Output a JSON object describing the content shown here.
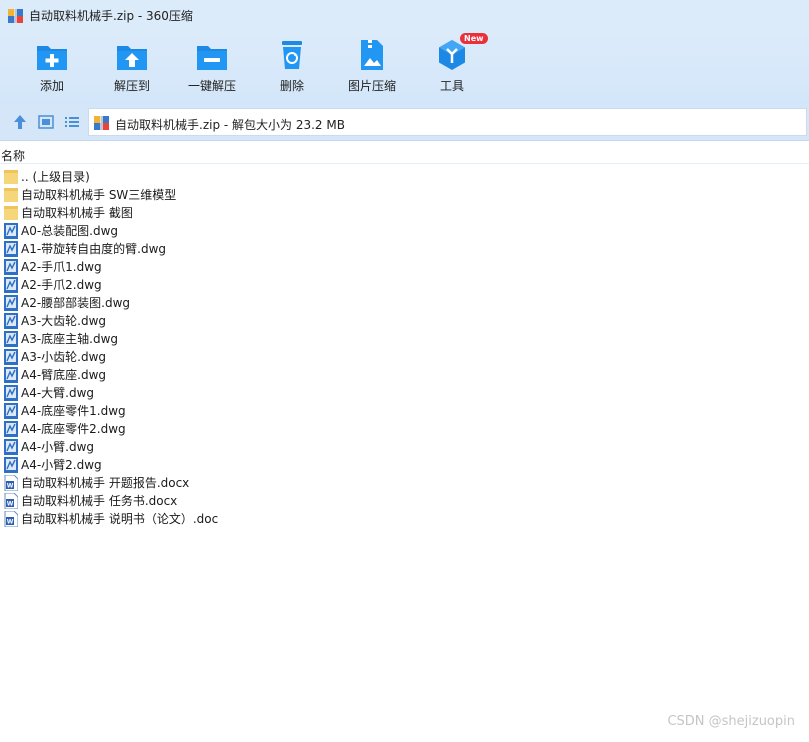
{
  "window": {
    "title": "自动取料机械手.zip - 360压缩"
  },
  "toolbar": {
    "items": [
      {
        "label": "添加",
        "icon": "add-icon"
      },
      {
        "label": "解压到",
        "icon": "extract-to-icon"
      },
      {
        "label": "一键解压",
        "icon": "one-click-extract-icon"
      },
      {
        "label": "删除",
        "icon": "delete-icon"
      },
      {
        "label": "图片压缩",
        "icon": "image-compress-icon"
      },
      {
        "label": "工具",
        "icon": "tools-icon",
        "badge": "New"
      }
    ]
  },
  "address": {
    "text": "自动取料机械手.zip - 解包大小为 23.2 MB"
  },
  "list": {
    "header": "名称",
    "items": [
      {
        "name": ".. (上级目录)",
        "type": "folder"
      },
      {
        "name": "自动取料机械手 SW三维模型",
        "type": "folder"
      },
      {
        "name": "自动取料机械手 截图",
        "type": "folder"
      },
      {
        "name": "A0-总装配图.dwg",
        "type": "dwg"
      },
      {
        "name": "A1-带旋转自由度的臂.dwg",
        "type": "dwg"
      },
      {
        "name": "A2-手爪1.dwg",
        "type": "dwg"
      },
      {
        "name": "A2-手爪2.dwg",
        "type": "dwg"
      },
      {
        "name": "A2-腰部部装图.dwg",
        "type": "dwg"
      },
      {
        "name": "A3-大齿轮.dwg",
        "type": "dwg"
      },
      {
        "name": "A3-底座主轴.dwg",
        "type": "dwg"
      },
      {
        "name": "A3-小齿轮.dwg",
        "type": "dwg"
      },
      {
        "name": "A4-臂底座.dwg",
        "type": "dwg"
      },
      {
        "name": "A4-大臂.dwg",
        "type": "dwg"
      },
      {
        "name": "A4-底座零件1.dwg",
        "type": "dwg"
      },
      {
        "name": "A4-底座零件2.dwg",
        "type": "dwg"
      },
      {
        "name": "A4-小臂.dwg",
        "type": "dwg"
      },
      {
        "name": "A4-小臂2.dwg",
        "type": "dwg"
      },
      {
        "name": "自动取料机械手 开题报告.docx",
        "type": "doc"
      },
      {
        "name": "自动取料机械手 任务书.docx",
        "type": "doc"
      },
      {
        "name": "自动取料机械手 说明书（论文）.doc",
        "type": "doc"
      }
    ]
  },
  "watermark": "CSDN @shejizuopin",
  "colors": {
    "accent": "#1e88e5",
    "toolbar_bg": "#dcebfa",
    "folder": "#f5d67a"
  }
}
